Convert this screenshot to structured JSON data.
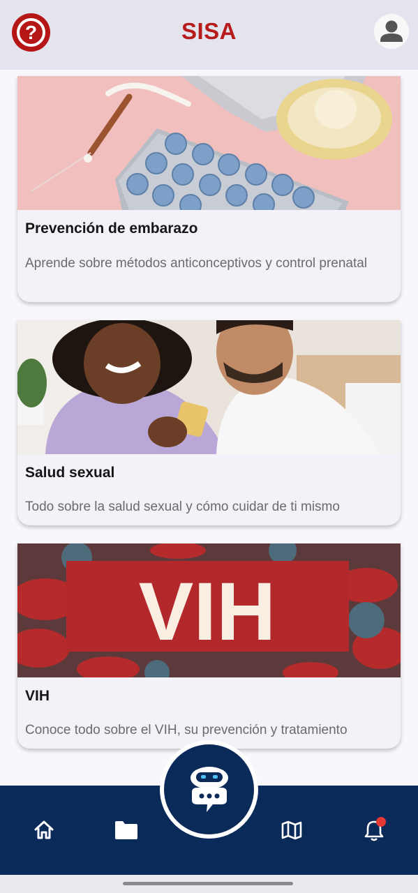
{
  "header": {
    "title": "SISA",
    "help_icon": "help-circle-icon",
    "profile_icon": "user-avatar-icon",
    "brand_color": "#b71c1c"
  },
  "cards": [
    {
      "title": "Prevención de embarazo",
      "description": "Aprende sobre métodos anticonceptivos y control prenatal",
      "image": "contraceptives-photo"
    },
    {
      "title": "Salud sexual",
      "description": "Todo sobre la salud sexual y cómo cuidar de ti mismo",
      "image": "couple-photo"
    },
    {
      "title": "VIH",
      "description": "Conoce todo sobre el VIH, su prevención y tratamiento",
      "image": "vih-banner",
      "image_text": "VIH"
    }
  ],
  "bottom_nav": {
    "items": [
      {
        "icon": "home-icon"
      },
      {
        "icon": "folder-icon"
      },
      {
        "icon": "chatbot-icon"
      },
      {
        "icon": "map-icon"
      },
      {
        "icon": "bell-icon",
        "has_badge": true
      }
    ],
    "background_color": "#0a2a5a"
  }
}
